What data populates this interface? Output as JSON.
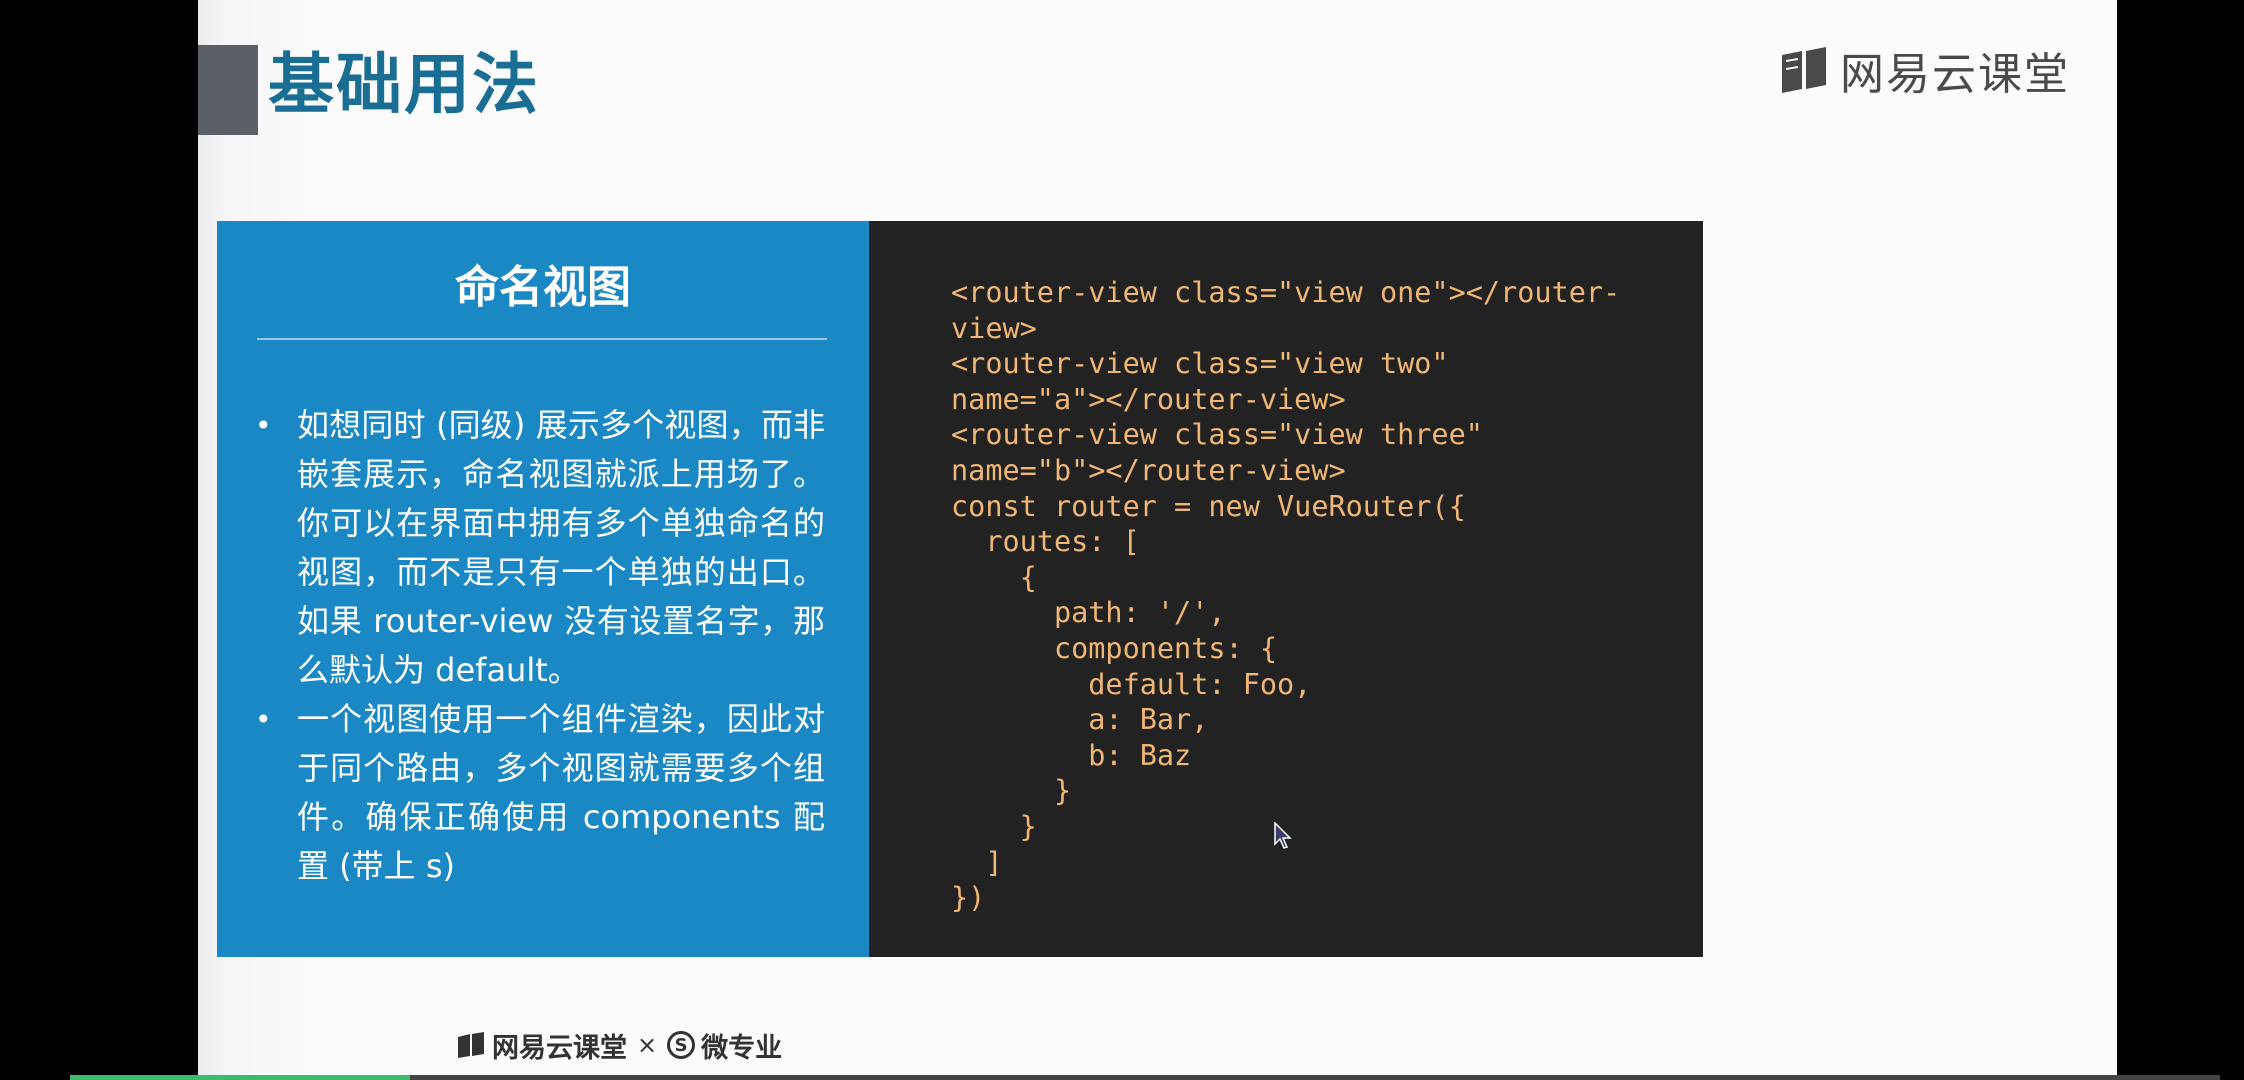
{
  "slide": {
    "title": "基础用法",
    "brand": "网易云课堂",
    "panel_heading": "命名视图",
    "bullets": [
      "如想同时 (同级) 展示多个视图，而非嵌套展示，命名视图就派上用场了。你可以在界面中拥有多个单独命名的视图，而不是只有一个单独的出口。如果 router-view 没有设置名字，那么默认为 default。",
      "一个视图使用一个组件渲染，因此对于同个路由，多个视图就需要多个组件。确保正确使用 components 配置 (带上 s)"
    ],
    "code": "<router-view class=\"view one\"></router-\nview>\n<router-view class=\"view two\"\nname=\"a\"></router-view>\n<router-view class=\"view three\"\nname=\"b\"></router-view>\nconst router = new VueRouter({\n  routes: [\n    {\n      path: '/',\n      components: {\n        default: Foo,\n        a: Bar,\n        b: Baz\n      }\n    }\n  ]\n})",
    "footer": {
      "brand": "网易云课堂",
      "separator": "×",
      "partner_icon": "S",
      "partner": "微专业"
    }
  },
  "player": {
    "progress_fraction": 0.158
  },
  "colors": {
    "title": "#1b6e93",
    "left_panel": "#1a88c4",
    "code_bg": "#222222",
    "code_text": "#f0b774",
    "progress": "#3dbb6a"
  }
}
